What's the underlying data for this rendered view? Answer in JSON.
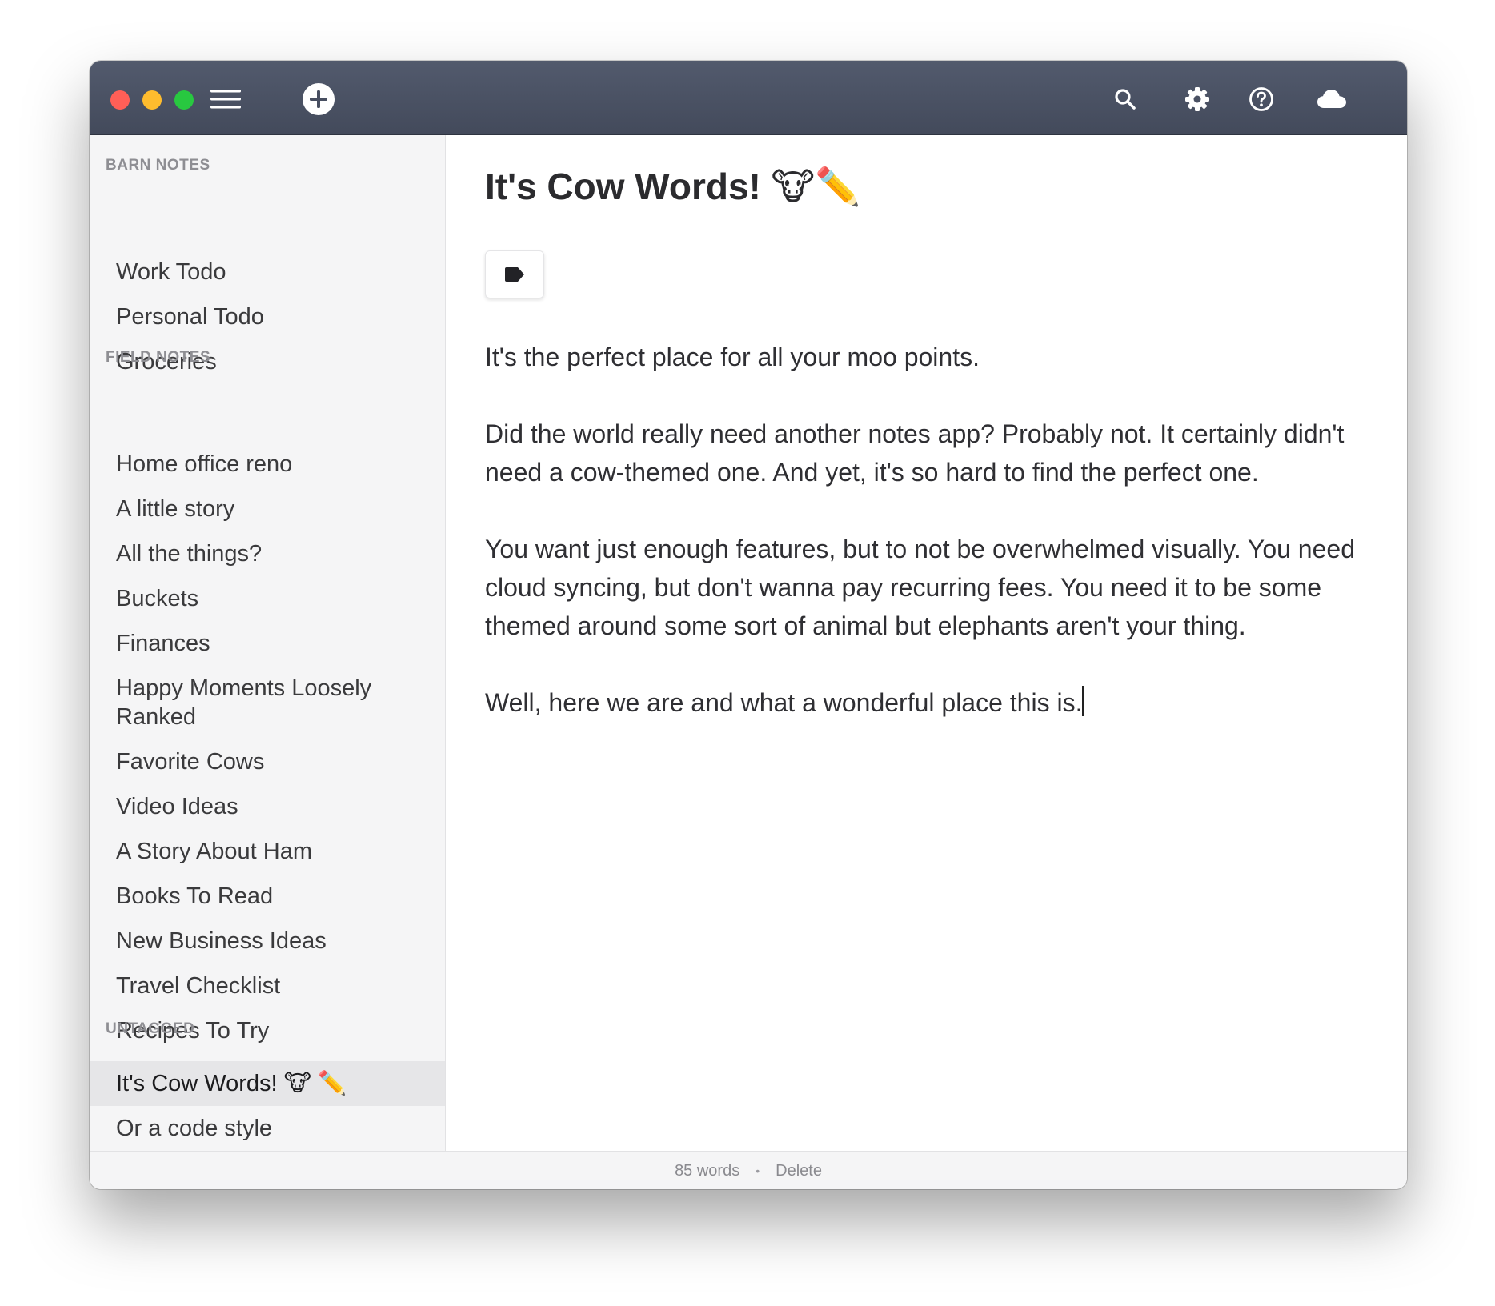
{
  "titlebar": {
    "traffic_colors": {
      "red": "#ff5f57",
      "yellow": "#febc2e",
      "green": "#28c840"
    },
    "icons": [
      "menu-icon",
      "add-note-icon",
      "search-icon",
      "gear-icon",
      "help-icon",
      "cloud-icon"
    ]
  },
  "sidebar": {
    "sections": [
      {
        "title": "BARN NOTES",
        "items": [
          "Work Todo",
          "Personal Todo",
          "Groceries"
        ]
      },
      {
        "title": "FIELD NOTES",
        "items": [
          "Home office reno",
          "A little story",
          "All the things?",
          "Buckets",
          "Finances",
          "Happy Moments Loosely Ranked",
          "Favorite Cows",
          "Video Ideas",
          "A Story About Ham",
          "Books To Read",
          "New Business Ideas",
          "Travel Checklist",
          "Recipes To Try"
        ]
      },
      {
        "title": "UNTAGGED",
        "items": [
          "It's Cow Words! 🐮 ✏️",
          "Or a code style"
        ],
        "selected_index": 0
      }
    ]
  },
  "editor": {
    "title": "It's Cow Words! 🐮✏️",
    "tag_icon": "tag-icon",
    "paragraphs": [
      "It's the perfect place for all your moo points.",
      "Did the world really need another notes app? Probably not. It certainly didn't need a cow-themed one. And yet, it's so hard to find the perfect one.",
      "You want just enough features, but to not be overwhelmed visually. You need cloud syncing, but don't wanna pay recurring fees. You need it to be some themed around some sort of animal but elephants aren't your thing.",
      "Well, here we are and what a wonderful place this is."
    ]
  },
  "footer": {
    "word_count": "85 words",
    "separator": "•",
    "delete_label": "Delete"
  }
}
